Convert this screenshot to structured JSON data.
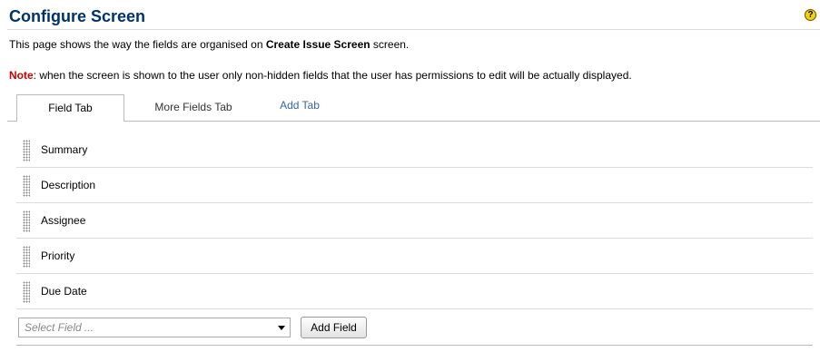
{
  "page": {
    "title": "Configure Screen",
    "help_glyph": "?",
    "desc_prefix": "This page shows the way the fields are organised on ",
    "screen_name": "Create Issue Screen",
    "desc_suffix": " screen.",
    "note_label": "Note",
    "note_text": ": when the screen is shown to the user only non-hidden fields that the user has permissions to edit will be actually displayed."
  },
  "tabs": {
    "active": "Field Tab",
    "other": "More Fields Tab",
    "add": "Add Tab"
  },
  "fields": [
    "Summary",
    "Description",
    "Assignee",
    "Priority",
    "Due Date"
  ],
  "add_field": {
    "placeholder": "Select Field ...",
    "button": "Add Field"
  },
  "colors": {
    "title": "#003366",
    "note_label": "#cc0000",
    "link": "#3366aa"
  }
}
